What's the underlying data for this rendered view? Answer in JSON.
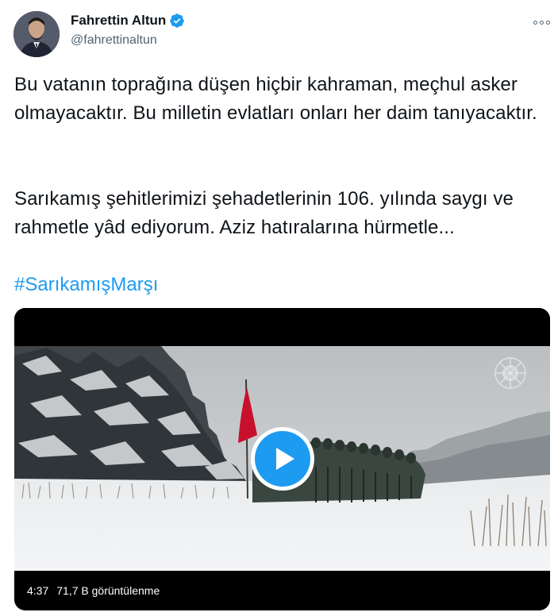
{
  "author": {
    "display_name": "Fahrettin Altun",
    "handle": "@fahrettinaltun",
    "verified": true,
    "avatar_icon": "profile-photo"
  },
  "tweet": {
    "paragraph_1": "Bu vatanın toprağına düşen hiçbir kahraman, meçhul asker olmayacaktır. Bu milletin evlatları onları her daim tanıyacaktır.",
    "paragraph_2": "Sarıkamış şehitlerimizi şehadetlerinin 106. yılında saygı ve rahmetle yâd ediyorum. Aziz hatıralarına hürmetle...",
    "hashtag": "#SarıkamışMarşı"
  },
  "video": {
    "duration": "4:37",
    "views": "71,7 B görüntülenme",
    "play_icon": "play-icon"
  },
  "colors": {
    "text": "#0f1419",
    "secondary": "#536471",
    "accent": "#1d9bf0",
    "flag": "#c8102e"
  }
}
